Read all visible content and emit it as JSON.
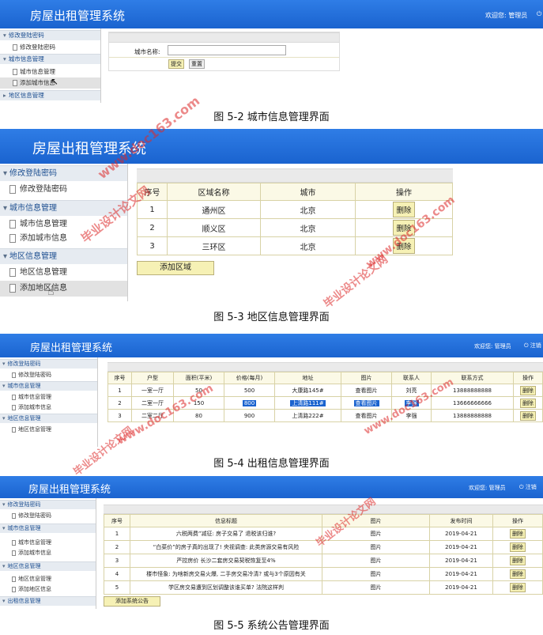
{
  "app_title": "房屋出租管理系统",
  "welcome": "欢迎您: 管理员",
  "logout": "注销",
  "menu": {
    "account": "修改登陆密码",
    "account_item": "修改登陆密码",
    "city": "城市信息管理",
    "city_items": [
      "城市信息管理",
      "添加城市信息"
    ],
    "district": "地区信息管理",
    "district_items": [
      "地区信息管理",
      "添加地区信息"
    ],
    "rental": "出租信息管理"
  },
  "fig2": {
    "field_label": "城市名称:",
    "submit": "提交",
    "reset": "重置",
    "caption": "图 5-2 城市信息管理界面"
  },
  "fig3": {
    "headers": [
      "序号",
      "区域名称",
      "城市",
      "操作"
    ],
    "rows": [
      [
        "1",
        "通州区",
        "北京",
        "删除"
      ],
      [
        "2",
        "顺义区",
        "北京",
        "删除"
      ],
      [
        "3",
        "三环区",
        "北京",
        "删除"
      ]
    ],
    "add_button": "添加区域",
    "caption": "图 5-3 地区信息管理界面"
  },
  "fig4": {
    "headers": [
      "序号",
      "户型",
      "面积(平米)",
      "价格(每月)",
      "地址",
      "图片",
      "联系人",
      "联系方式",
      "操作"
    ],
    "rows": [
      [
        "1",
        "一室一厅",
        "50",
        "500",
        "大康路145#",
        "查看图片",
        "刘亮",
        "13888888888",
        "删除"
      ],
      [
        "2",
        "二室一厅",
        "150",
        "800",
        "上清路111#",
        "查看图片",
        "李强",
        "13666666666",
        "删除"
      ],
      [
        "3",
        "二室二厅",
        "80",
        "900",
        "上清路222#",
        "查看图片",
        "李强",
        "13888888888",
        "删除"
      ]
    ],
    "caption": "图 5-4 出租信息管理界面"
  },
  "fig5": {
    "headers": [
      "序号",
      "信息标题",
      "图片",
      "发布时间",
      "操作"
    ],
    "rows": [
      [
        "1",
        "六税两费”减征: 房子交易了 退税该归谁?",
        "图片",
        "2019-04-21",
        "删除"
      ],
      [
        "2",
        "“白菜价”的房子真的出现了! 央视调查: 此类房源交易有风险",
        "图片",
        "2019-04-21",
        "删除"
      ],
      [
        "3",
        "严控房价 长沙二套房交易契税恢复至4%",
        "图片",
        "2019-04-21",
        "删除"
      ],
      [
        "4",
        "楼市怪象: 为啥新房交易火爆, 二手房交易冷清? 或与3个原因有关",
        "图片",
        "2019-04-21",
        "删除"
      ],
      [
        "5",
        "学区房交易遭到区划调整该谁买单? 法院这样判",
        "图片",
        "2019-04-21",
        "删除"
      ]
    ],
    "add_button": "添加系统公告",
    "caption": "图 5-5 系统公告管理界面"
  },
  "watermark": {
    "site": "www.doc163.com",
    "brand": "毕业设计论文网"
  }
}
